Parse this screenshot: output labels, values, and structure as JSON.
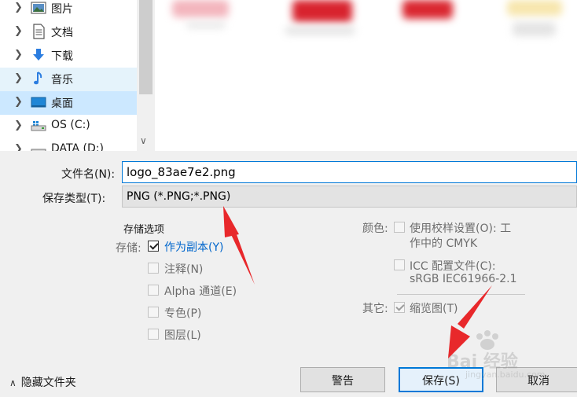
{
  "nav_tree": {
    "items": [
      {
        "label": "图片",
        "icon": "pictures-folder-icon",
        "state": "normal"
      },
      {
        "label": "文档",
        "icon": "documents-folder-icon",
        "state": "normal"
      },
      {
        "label": "下载",
        "icon": "downloads-arrow-icon",
        "state": "normal"
      },
      {
        "label": "音乐",
        "icon": "music-note-icon",
        "state": "hover"
      },
      {
        "label": "桌面",
        "icon": "desktop-icon",
        "state": "selected"
      },
      {
        "label": "OS (C:)",
        "icon": "windows-drive-icon",
        "state": "normal"
      },
      {
        "label": "DATA (D:)",
        "icon": "drive-icon",
        "state": "normal"
      }
    ]
  },
  "form": {
    "filename_label": "文件名(N):",
    "filename_value": "logo_83ae7e2.png",
    "filetype_label": "保存类型(T):",
    "filetype_value": "PNG (*.PNG;*.PNG)"
  },
  "options": {
    "section_title": "存储选项",
    "store_label": "存储:",
    "items": [
      {
        "label": "作为副本(Y)",
        "checked": true,
        "enabled": true
      },
      {
        "label": "注释(N)",
        "checked": false,
        "enabled": false
      },
      {
        "label": "Alpha 通道(E)",
        "checked": false,
        "enabled": false
      },
      {
        "label": "专色(P)",
        "checked": false,
        "enabled": false
      },
      {
        "label": "图层(L)",
        "checked": false,
        "enabled": false
      }
    ],
    "color_label": "颜色:",
    "proof_setup_line1": "使用校样设置(O):  工",
    "proof_setup_line2": "作中的 CMYK",
    "icc_line1": "ICC 配置文件(C):",
    "icc_line2": "sRGB IEC61966-2.1",
    "other_label": "其它:",
    "thumbnail_label": "缩览图(T)"
  },
  "footer": {
    "hide_folders": "隐藏文件夹",
    "warning_button": "警告",
    "save_button": "保存(S)",
    "cancel_button": "取消"
  },
  "watermark": {
    "text": "Bai 经验",
    "sub": "jingyan.baidu.com"
  },
  "colors": {
    "accent": "#0078d7",
    "link_blue": "#0066cc",
    "annotation_red": "#e8282b",
    "selected_bg": "#cce8ff",
    "hover_bg": "#e5f3fb"
  }
}
